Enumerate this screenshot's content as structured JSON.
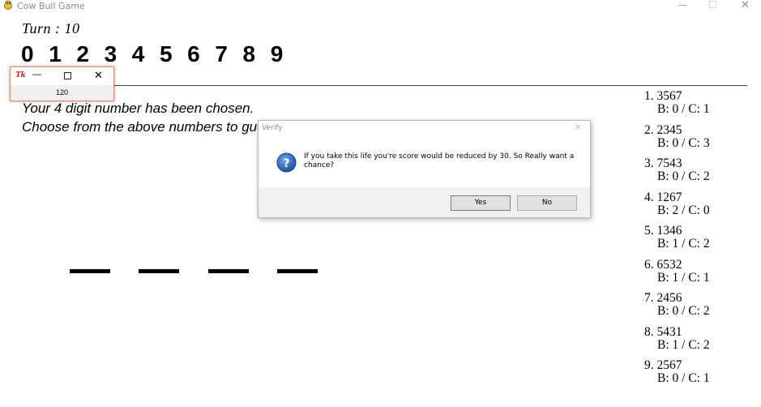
{
  "window": {
    "title": "Cow Bull Game",
    "icon": "pygame-snake-icon"
  },
  "game": {
    "turn_label": "Turn : 10",
    "digits": [
      "0",
      "1",
      "2",
      "3",
      "4",
      "5",
      "6",
      "7",
      "8",
      "9"
    ],
    "message_line1": "Your 4 digit number has been chosen.",
    "message_line2": "Choose from the above numbers to guess it",
    "slots": 4
  },
  "history": [
    {
      "guess": "1. 3567",
      "result": "B: 0 / C: 1"
    },
    {
      "guess": "2. 2345",
      "result": "B: 0 / C: 3"
    },
    {
      "guess": "3. 7543",
      "result": "B: 0 / C: 2"
    },
    {
      "guess": "4. 1267",
      "result": "B: 2 / C: 0"
    },
    {
      "guess": "5. 1346",
      "result": "B: 1 / C: 2"
    },
    {
      "guess": "6. 6532",
      "result": "B: 1 / C: 1"
    },
    {
      "guess": "7. 2456",
      "result": "B: 0 / C: 2"
    },
    {
      "guess": "8. 5431",
      "result": "B: 1 / C: 2"
    },
    {
      "guess": "9. 2567",
      "result": "B: 0 / C: 1"
    }
  ],
  "tk_window": {
    "logo": "Tk",
    "value": "120"
  },
  "dialog": {
    "title": "Verify",
    "message": "If you take this life you're score would be reduced by 30. So Really want a chance?",
    "yes_label": "Yes",
    "no_label": "No",
    "icon": "question-icon"
  },
  "colors": {
    "accent_border": "#d98b6a",
    "question_blue": "#1f5fb8"
  }
}
